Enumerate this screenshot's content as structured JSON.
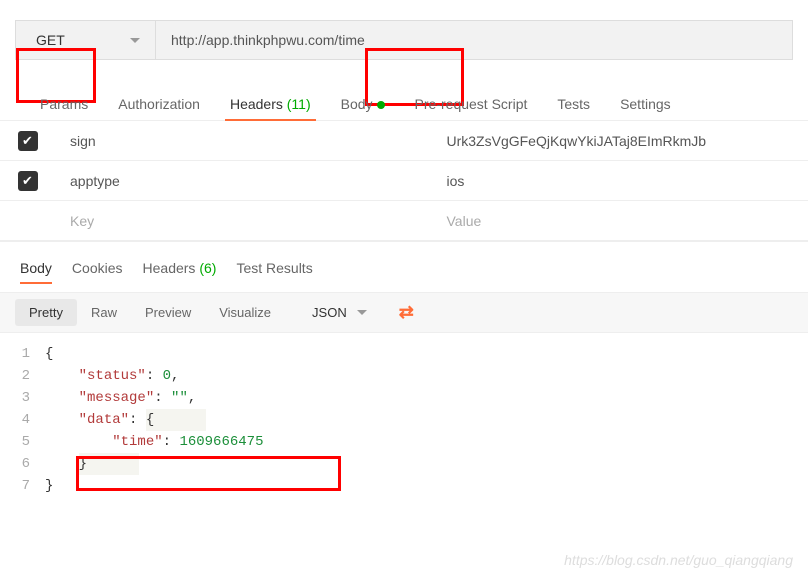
{
  "request": {
    "method": "GET",
    "url": "http://app.thinkphpwu.com/time"
  },
  "tabs": {
    "params": "Params",
    "authorization": "Authorization",
    "headers": "Headers",
    "headers_count": "(11)",
    "body": "Body",
    "prerequest": "Pre-request Script",
    "tests": "Tests",
    "settings": "Settings"
  },
  "headers_rows": [
    {
      "key": "sign",
      "value": "Urk3ZsVgGFeQjKqwYkiJATaj8EImRkmJb"
    },
    {
      "key": "apptype",
      "value": "ios"
    }
  ],
  "headers_placeholder": {
    "key": "Key",
    "value": "Value"
  },
  "response_tabs": {
    "body": "Body",
    "cookies": "Cookies",
    "headers": "Headers",
    "headers_count": "(6)",
    "test_results": "Test Results"
  },
  "toolbar": {
    "pretty": "Pretty",
    "raw": "Raw",
    "preview": "Preview",
    "visualize": "Visualize",
    "format": "JSON"
  },
  "response_json": {
    "line1": "{",
    "line2_key": "\"status\"",
    "line2_val": "0",
    "line3_key": "\"message\"",
    "line3_val": "\"\"",
    "line4_key": "\"data\"",
    "line5_key": "\"time\"",
    "line5_val": "1609666475",
    "line6": "}",
    "line7": "}"
  },
  "watermark": "https://blog.csdn.net/guo_qiangqiang"
}
